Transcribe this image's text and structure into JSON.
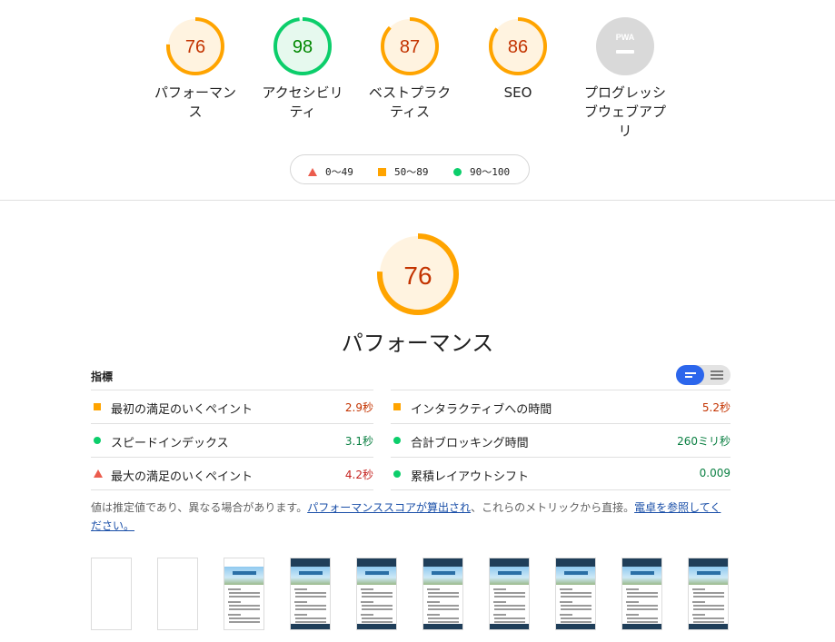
{
  "gauges": [
    {
      "score": "76",
      "label": "パフォーマンス",
      "color": "#ffa400",
      "bg": "#fff3e0",
      "text_color": "#c33300",
      "fraction": 0.76
    },
    {
      "score": "98",
      "label": "アクセシビリティ",
      "color": "#0cce6b",
      "bg": "#e6f9ee",
      "text_color": "#008800",
      "fraction": 0.98
    },
    {
      "score": "87",
      "label": "ベストプラクティス",
      "color": "#ffa400",
      "bg": "#fff3e0",
      "text_color": "#c33300",
      "fraction": 0.87
    },
    {
      "score": "86",
      "label": "SEO",
      "color": "#ffa400",
      "bg": "#fff3e0",
      "text_color": "#c33300",
      "fraction": 0.86
    },
    {
      "score": "PWA",
      "label": "プログレッシブウェブアプリ",
      "color": "#d9d9d9",
      "bg": "#d9d9d9",
      "text_color": "#ffffff",
      "fraction": 0
    }
  ],
  "legend": {
    "fail": "0〜49",
    "average": "50〜89",
    "pass": "90〜100",
    "colors": {
      "fail": "#eb5c4d",
      "average": "#ffa400",
      "pass": "#0cce6b"
    }
  },
  "performance": {
    "score": "76",
    "title": "パフォーマンス",
    "fraction": 0.76
  },
  "metrics": {
    "heading": "指標",
    "left": [
      {
        "icon": "average-square-icon",
        "name": "最初の満足のいくペイント",
        "value": "2.9秒",
        "rating": "orange"
      },
      {
        "icon": "pass-circle-icon",
        "name": "スピードインデックス",
        "value": "3.1秒",
        "rating": "green"
      },
      {
        "icon": "fail-triangle-icon",
        "name": "最大の満足のいくペイント",
        "value": "4.2秒",
        "rating": "red"
      }
    ],
    "right": [
      {
        "icon": "average-square-icon",
        "name": "インタラクティブへの時間",
        "value": "5.2秒",
        "rating": "orange"
      },
      {
        "icon": "pass-circle-icon",
        "name": "合計ブロッキング時間",
        "value": "260ミリ秒",
        "rating": "green"
      },
      {
        "icon": "pass-circle-icon",
        "name": "累積レイアウトシフト",
        "value": "0.009",
        "rating": "green"
      }
    ]
  },
  "note": {
    "text1": "値は推定値であり、異なる場合があります。",
    "link1": "パフォーマンススコアが算出され",
    "text2": "、これらのメトリックから直接。",
    "link2": "電卓を参照してください。"
  },
  "filmstrip": {
    "frames": [
      "blank",
      "blank",
      "partial",
      "full",
      "full",
      "full",
      "full",
      "full",
      "full",
      "full"
    ]
  }
}
